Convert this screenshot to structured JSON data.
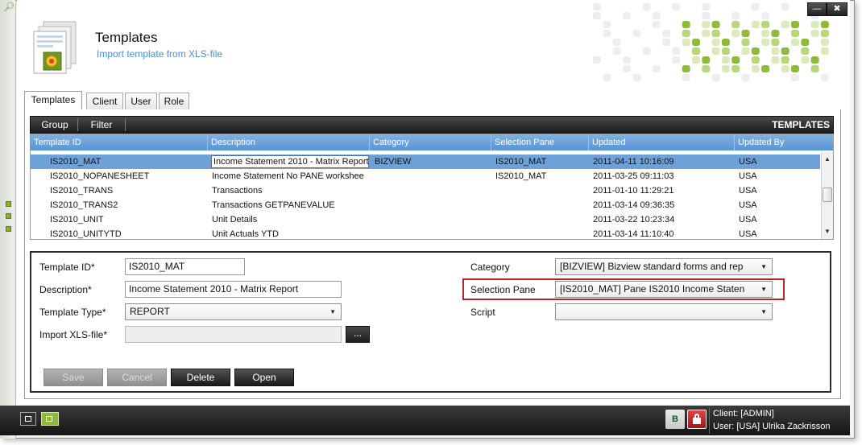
{
  "header": {
    "title": "Templates",
    "subtitle": "Import template from XLS-file",
    "window_minimize": "—",
    "window_close": "✖"
  },
  "tabs": [
    {
      "label": "Templates",
      "active": true
    },
    {
      "label": "Client",
      "active": false
    },
    {
      "label": "User",
      "active": false
    },
    {
      "label": "Role",
      "active": false
    }
  ],
  "toolbar": {
    "group_label": "Group",
    "filter_label": "Filter",
    "title": "TEMPLATES"
  },
  "grid": {
    "columns": [
      "Template ID",
      "Description",
      "Category",
      "Selection Pane",
      "Updated",
      "Updated By"
    ],
    "rows": [
      {
        "id": "IS2010_MAT",
        "description": "Income Statement 2010 - Matrix Report",
        "category": "BIZVIEW",
        "pane": "IS2010_MAT",
        "updated": "2011-04-11 10:16:09",
        "by": "USA",
        "selected": true
      },
      {
        "id": "IS2010_NOPANESHEET",
        "description": "Income Statement No PANE workshee",
        "category": "",
        "pane": "IS2010_MAT",
        "updated": "2011-03-25 09:11:03",
        "by": "USA",
        "selected": false
      },
      {
        "id": "IS2010_TRANS",
        "description": "Transactions",
        "category": "",
        "pane": "",
        "updated": "2011-01-10 11:29:21",
        "by": "USA",
        "selected": false
      },
      {
        "id": "IS2010_TRANS2",
        "description": "Transactions GETPANEVALUE",
        "category": "",
        "pane": "",
        "updated": "2011-03-14 09:36:35",
        "by": "USA",
        "selected": false
      },
      {
        "id": "IS2010_UNIT",
        "description": "Unit Details",
        "category": "",
        "pane": "",
        "updated": "2011-03-22 10:23:34",
        "by": "USA",
        "selected": false
      },
      {
        "id": "IS2010_UNITYTD",
        "description": "Unit Actuals YTD",
        "category": "",
        "pane": "",
        "updated": "2011-03-14 11:10:40",
        "by": "USA",
        "selected": false
      }
    ],
    "scroll_up": "▲",
    "scroll_down": "▼"
  },
  "form": {
    "template_id_label": "Template ID*",
    "template_id_value": "IS2010_MAT",
    "description_label": "Description*",
    "description_value": "Income Statement 2010 - Matrix Report",
    "template_type_label": "Template Type*",
    "template_type_value": "REPORT",
    "import_label": "Import XLS-file*",
    "import_value": "",
    "browse_label": "...",
    "category_label": "Category",
    "category_value": "[BIZVIEW] Bizview standard forms and rep",
    "selection_pane_label": "Selection Pane",
    "selection_pane_value": "[IS2010_MAT] Pane IS2010 Income Staten",
    "script_label": "Script",
    "script_value": "",
    "caret": "▼"
  },
  "actions": {
    "save": "Save",
    "cancel": "Cancel",
    "delete": "Delete",
    "open": "Open"
  },
  "statusbar": {
    "client": "Client: [ADMIN]",
    "user": "User: [USA] Ulrika Zackrisson",
    "lang_icon": "B"
  },
  "colors": {
    "accent_blue": "#6ea1d8",
    "highlight_red": "#b3262c",
    "brand_green": "#8ebc3a"
  }
}
